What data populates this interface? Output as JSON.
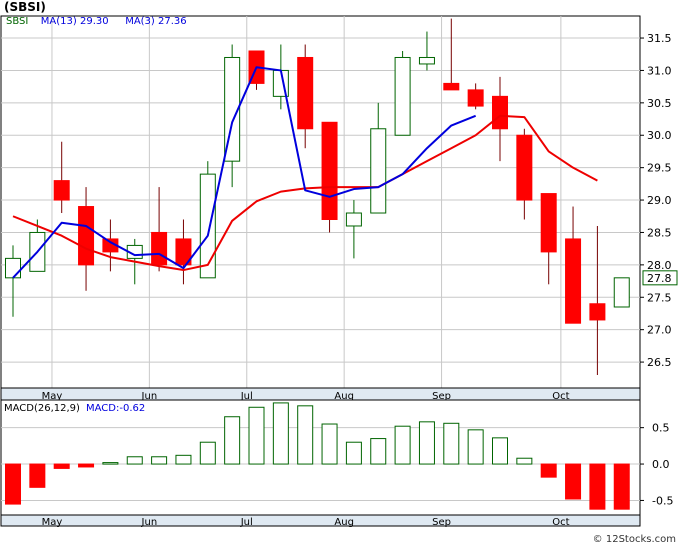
{
  "chart_data": {
    "type": "candlestick",
    "title": "(SBSI)",
    "ticker": "SBSI",
    "credit": "© 12Stocks.com",
    "colors": {
      "up": "#006400",
      "down": "#ff0000",
      "ma13": "#0000dd",
      "ma3": "#ee0000",
      "macd": "#006400",
      "grid": "#c8c8c8",
      "panel_bg": "#ffffff",
      "frame": "#000000",
      "axis_band": "#dfe9f2"
    },
    "legend": [
      {
        "label": "SBSI",
        "color": "#006400"
      },
      {
        "label": "MA(13)",
        "value": "29.30",
        "color": "#0000dd"
      },
      {
        "label": "MA(3)",
        "value": "27.36",
        "color": "#0000dd"
      }
    ],
    "price_axis": {
      "ticks": [
        26.5,
        27.0,
        27.5,
        28.0,
        28.5,
        29.0,
        29.5,
        30.0,
        30.5,
        31.0,
        31.5
      ],
      "tick_labels": [
        "26.5",
        "27.0",
        "27.5",
        "28.0",
        "28.5",
        "29.0",
        "29.5",
        "30.0",
        "30.5",
        "31.0",
        "31.5"
      ],
      "range": [
        26.1,
        31.84
      ]
    },
    "last_price": {
      "value": 27.8,
      "label": "27.8"
    },
    "months": [
      "May",
      "Jun",
      "Jul",
      "Aug",
      "Sep",
      "Oct"
    ],
    "month_positions": [
      1.6,
      5.6,
      9.6,
      13.6,
      17.6,
      22.5
    ],
    "candles": [
      {
        "o": 27.8,
        "h": 28.3,
        "l": 27.2,
        "c": 28.1
      },
      {
        "o": 27.9,
        "h": 28.7,
        "l": 27.9,
        "c": 28.5
      },
      {
        "o": 29.3,
        "h": 29.9,
        "l": 28.8,
        "c": 29.0
      },
      {
        "o": 28.9,
        "h": 29.2,
        "l": 27.6,
        "c": 28.0
      },
      {
        "o": 28.4,
        "h": 28.7,
        "l": 27.9,
        "c": 28.2
      },
      {
        "o": 28.1,
        "h": 28.4,
        "l": 27.7,
        "c": 28.3
      },
      {
        "o": 28.5,
        "h": 29.2,
        "l": 27.9,
        "c": 28.0
      },
      {
        "o": 28.4,
        "h": 28.7,
        "l": 27.7,
        "c": 28.0
      },
      {
        "o": 27.8,
        "h": 29.6,
        "l": 27.8,
        "c": 29.4
      },
      {
        "o": 29.6,
        "h": 31.4,
        "l": 29.2,
        "c": 31.2
      },
      {
        "o": 31.3,
        "h": 31.3,
        "l": 30.7,
        "c": 30.8
      },
      {
        "o": 30.6,
        "h": 31.4,
        "l": 30.4,
        "c": 31.0
      },
      {
        "o": 31.2,
        "h": 31.4,
        "l": 29.8,
        "c": 30.1
      },
      {
        "o": 30.2,
        "h": 30.2,
        "l": 28.5,
        "c": 28.7
      },
      {
        "o": 28.6,
        "h": 29.0,
        "l": 28.1,
        "c": 28.8
      },
      {
        "o": 28.8,
        "h": 30.5,
        "l": 28.8,
        "c": 30.1
      },
      {
        "o": 30.0,
        "h": 31.3,
        "l": 30.0,
        "c": 31.2
      },
      {
        "o": 31.1,
        "h": 31.6,
        "l": 31.0,
        "c": 31.2
      },
      {
        "o": 30.8,
        "h": 31.8,
        "l": 30.7,
        "c": 30.7
      },
      {
        "o": 30.7,
        "h": 30.8,
        "l": 30.4,
        "c": 30.45
      },
      {
        "o": 30.6,
        "h": 30.9,
        "l": 29.6,
        "c": 30.1
      },
      {
        "o": 30.0,
        "h": 30.1,
        "l": 28.7,
        "c": 29.0
      },
      {
        "o": 29.1,
        "h": 29.1,
        "l": 27.7,
        "c": 28.2
      },
      {
        "o": 28.4,
        "h": 28.9,
        "l": 27.1,
        "c": 27.1
      },
      {
        "o": 27.4,
        "h": 28.6,
        "l": 26.3,
        "c": 27.15
      },
      {
        "o": 27.35,
        "h": 27.8,
        "l": 27.35,
        "c": 27.8
      }
    ],
    "ma13": [
      {
        "i": 0,
        "v": 27.8
      },
      {
        "i": 1,
        "v": 28.2
      },
      {
        "i": 2,
        "v": 28.65
      },
      {
        "i": 3,
        "v": 28.6
      },
      {
        "i": 4,
        "v": 28.35
      },
      {
        "i": 5,
        "v": 28.15
      },
      {
        "i": 6,
        "v": 28.17
      },
      {
        "i": 7,
        "v": 27.95
      },
      {
        "i": 8,
        "v": 28.45
      },
      {
        "i": 9,
        "v": 30.2
      },
      {
        "i": 10,
        "v": 31.05
      },
      {
        "i": 11,
        "v": 31.0
      },
      {
        "i": 12,
        "v": 29.15
      },
      {
        "i": 13,
        "v": 29.05
      },
      {
        "i": 14,
        "v": 29.17
      },
      {
        "i": 15,
        "v": 29.2
      },
      {
        "i": 16,
        "v": 29.4
      },
      {
        "i": 17,
        "v": 29.8
      },
      {
        "i": 18,
        "v": 30.15
      },
      {
        "i": 19,
        "v": 30.3
      }
    ],
    "ma3": [
      {
        "i": 0,
        "v": 28.75
      },
      {
        "i": 1,
        "v": 28.6
      },
      {
        "i": 2,
        "v": 28.45
      },
      {
        "i": 3,
        "v": 28.25
      },
      {
        "i": 4,
        "v": 28.12
      },
      {
        "i": 5,
        "v": 28.05
      },
      {
        "i": 6,
        "v": 27.98
      },
      {
        "i": 7,
        "v": 27.92
      },
      {
        "i": 8,
        "v": 28.0
      },
      {
        "i": 9,
        "v": 28.68
      },
      {
        "i": 10,
        "v": 28.98
      },
      {
        "i": 11,
        "v": 29.13
      },
      {
        "i": 12,
        "v": 29.18
      },
      {
        "i": 13,
        "v": 29.2
      },
      {
        "i": 14,
        "v": 29.2
      },
      {
        "i": 15,
        "v": 29.2
      },
      {
        "i": 16,
        "v": 29.4
      },
      {
        "i": 17,
        "v": 29.6
      },
      {
        "i": 18,
        "v": 29.8
      },
      {
        "i": 19,
        "v": 30.0
      },
      {
        "i": 20,
        "v": 30.3
      },
      {
        "i": 21,
        "v": 30.28
      },
      {
        "i": 22,
        "v": 29.75
      },
      {
        "i": 23,
        "v": 29.5
      },
      {
        "i": 24,
        "v": 29.3
      }
    ],
    "macd_panel": {
      "label": "MACD(26,12,9)",
      "value_label": "MACD:-0.62",
      "ticks": [
        0.5,
        0.0,
        -0.5
      ],
      "tick_labels": [
        "0.5",
        "0.0",
        "-0.5"
      ],
      "range": [
        -0.7,
        0.88
      ],
      "bars": [
        -0.55,
        -0.32,
        -0.06,
        -0.04,
        0.02,
        0.1,
        0.1,
        0.12,
        0.3,
        0.65,
        0.78,
        0.84,
        0.8,
        0.55,
        0.3,
        0.35,
        0.52,
        0.58,
        0.56,
        0.47,
        0.36,
        0.08,
        -0.18,
        -0.48,
        -0.62,
        -0.62
      ]
    }
  }
}
